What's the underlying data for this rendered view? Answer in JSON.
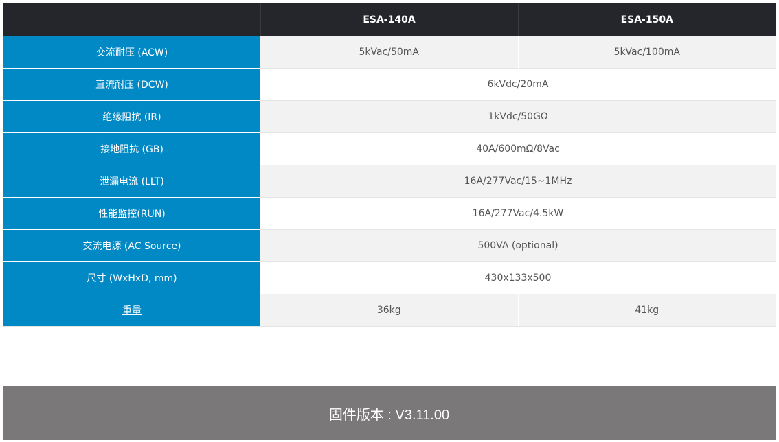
{
  "header": {
    "corner": "",
    "model_a": "ESA-140A",
    "model_b": "ESA-150A"
  },
  "rows": [
    {
      "label": "交流耐压 (ACW)",
      "a": "5kVac/50mA",
      "b": "5kVac/100mA"
    },
    {
      "label": "直流耐压 (DCW)",
      "shared": "6kVdc/20mA"
    },
    {
      "label": "绝缘阻抗 (IR)",
      "shared": "1kVdc/50GΩ"
    },
    {
      "label": "接地阻抗 (GB)",
      "shared": "40A/600mΩ/8Vac"
    },
    {
      "label": "泄漏电流 (LLT)",
      "shared": "16A/277Vac/15~1MHz"
    },
    {
      "label": "性能监控(RUN)",
      "shared": "16A/277Vac/4.5kW"
    },
    {
      "label": "交流电源 (AC Source)",
      "shared": "500VA (optional)"
    },
    {
      "label": "尺寸 (WxHxD, mm)",
      "shared": "430x133x500"
    },
    {
      "label": "重量",
      "a": "36kg",
      "b": "41kg"
    }
  ],
  "firmware": {
    "text": "固件版本 : V3.11.00"
  },
  "colors": {
    "header_bg": "#25262b",
    "label_bg": "#0089c5",
    "stripe_bg": "#f2f2f2",
    "footer_bg": "#7a7878"
  }
}
